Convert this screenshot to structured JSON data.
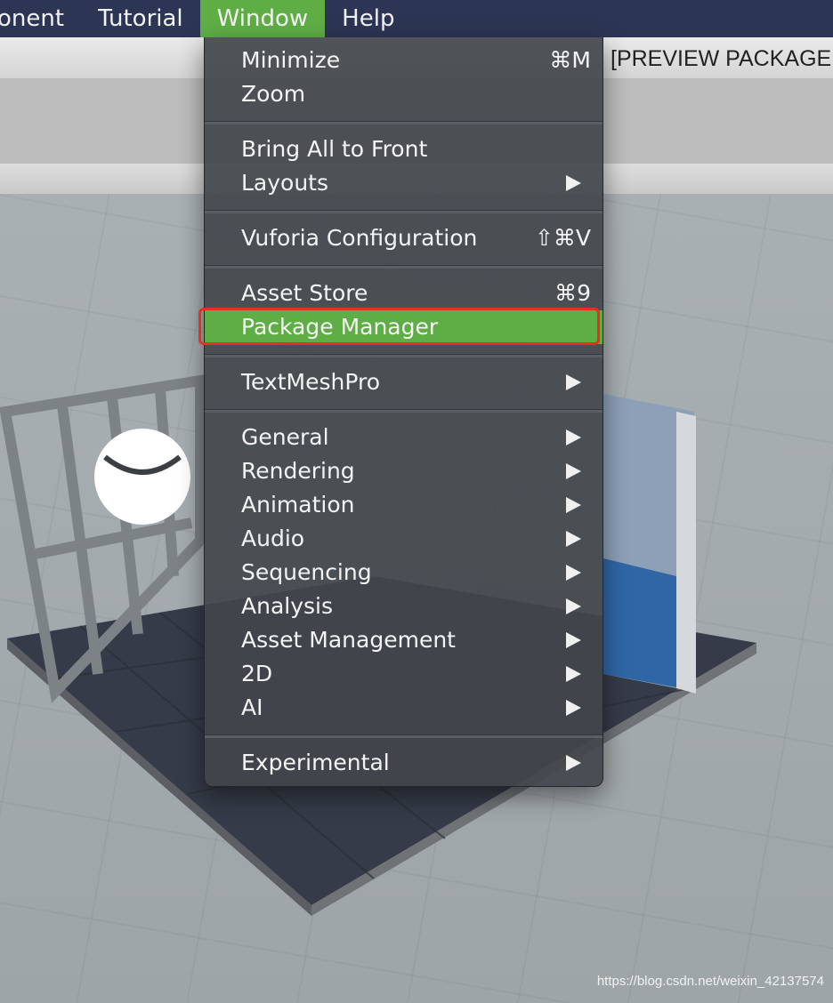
{
  "menubar": {
    "items": [
      {
        "label": "onent"
      },
      {
        "label": "Tutorial"
      },
      {
        "label": "Window"
      },
      {
        "label": "Help"
      }
    ]
  },
  "window_title": "[PREVIEW PACKAGE",
  "window_menu": {
    "minimize": {
      "label": "Minimize",
      "shortcut": "⌘M"
    },
    "zoom": {
      "label": "Zoom"
    },
    "bring_all": {
      "label": "Bring All to Front"
    },
    "layouts": {
      "label": "Layouts"
    },
    "vuforia": {
      "label": "Vuforia Configuration",
      "shortcut": "⇧⌘V"
    },
    "asset_store": {
      "label": "Asset Store",
      "shortcut": "⌘9"
    },
    "package_manager": {
      "label": "Package Manager"
    },
    "textmeshpro": {
      "label": "TextMeshPro"
    },
    "general": {
      "label": "General"
    },
    "rendering": {
      "label": "Rendering"
    },
    "animation": {
      "label": "Animation"
    },
    "audio": {
      "label": "Audio"
    },
    "sequencing": {
      "label": "Sequencing"
    },
    "analysis": {
      "label": "Analysis"
    },
    "asset_management": {
      "label": "Asset Management"
    },
    "twod": {
      "label": "2D"
    },
    "ai": {
      "label": "AI"
    },
    "experimental": {
      "label": "Experimental"
    }
  },
  "colors": {
    "menubar_bg": "#2c3553",
    "active_menu": "#5fae45",
    "highlight_border": "#e6301f"
  },
  "watermark": "https://blog.csdn.net/weixin_42137574"
}
